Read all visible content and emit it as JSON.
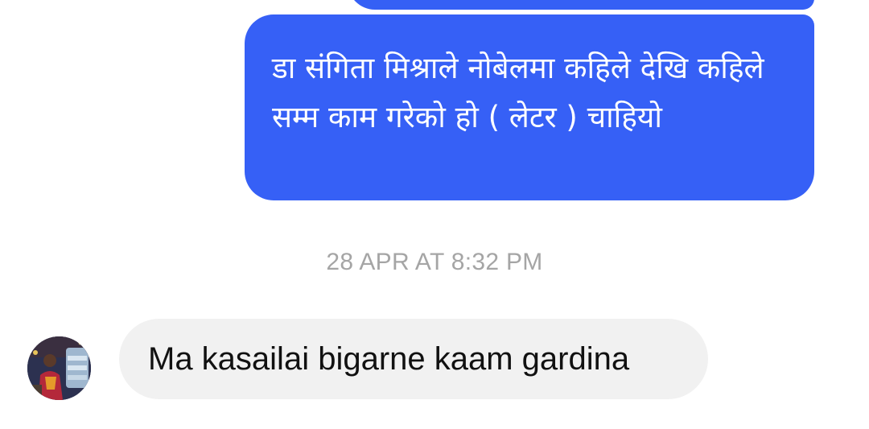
{
  "conversation": {
    "sent_message": {
      "text": "डा संगिता मिश्राले नोबेलमा कहिले देखि कहिले सम्म काम गरेको हो ( लेटर ) चाहियो"
    },
    "timestamp": "28 APR AT 8:32 PM",
    "received_message": {
      "text": "Ma kasailai bigarne kaam gardina",
      "avatar_icon": "contact-avatar-photo"
    }
  },
  "colors": {
    "sent_bubble": "#3660f6",
    "received_bubble": "#f1f1f1",
    "timestamp_text": "#a5a5a5"
  }
}
